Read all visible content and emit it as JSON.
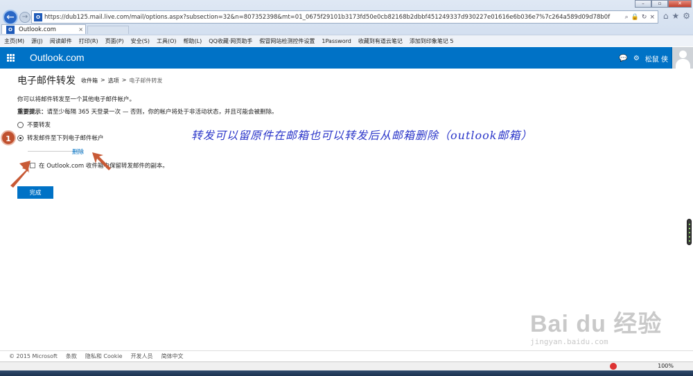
{
  "browser": {
    "url": "https://dub125.mail.live.com/mail/options.aspx?subsection=32&n=807352398&mt=01_0675f29101b3173fd50e0cb82168b2dbbf451249337d930227e01616e6b036e7%7c264a589d09d78b0f",
    "tab_title": "Outlook.com",
    "toolbar": [
      "主页(M)",
      "源(J)",
      "阅读邮件",
      "打印(R)",
      "页面(P)",
      "安全(S)",
      "工具(O)",
      "帮助(L)",
      "QQ收藏·网页助手",
      "假冒网站检测控件设置",
      "1Password",
      "收藏到有道云笔记",
      "添加到印象笔记 5"
    ]
  },
  "header": {
    "brand": "Outlook.com",
    "user_name": "松鼠 侠"
  },
  "content": {
    "page_title": "电子邮件转发",
    "breadcrumb": [
      "收件箱",
      "选项",
      "电子邮件转发"
    ],
    "intro": "你可以将邮件转发至一个其他电子邮件帐户。",
    "important_label": "重要提示：",
    "important_text": "请至少每隔 365 天登录一次 — 否则，你的帐户将处于非活动状态，并且可能会被删除。",
    "option_no_forward": "不要转发",
    "option_forward": "转发邮件至下列电子邮件帐户",
    "delete_link": "删除",
    "keep_copy": "在 Outlook.com 收件箱中保留转发邮件的副本。",
    "done_button": "完成"
  },
  "annotation": {
    "step": "1",
    "note": "转发可以留原件在邮箱也可以转发后从邮箱删除（outlook邮箱）"
  },
  "footer": [
    "© 2015 Microsoft",
    "条款",
    "隐私和 Cookie",
    "开发人员",
    "简体中文"
  ],
  "status": {
    "zoom": "100%"
  },
  "watermark": {
    "main": "Bai du 经验",
    "sub": "jingyan.baidu.com"
  }
}
